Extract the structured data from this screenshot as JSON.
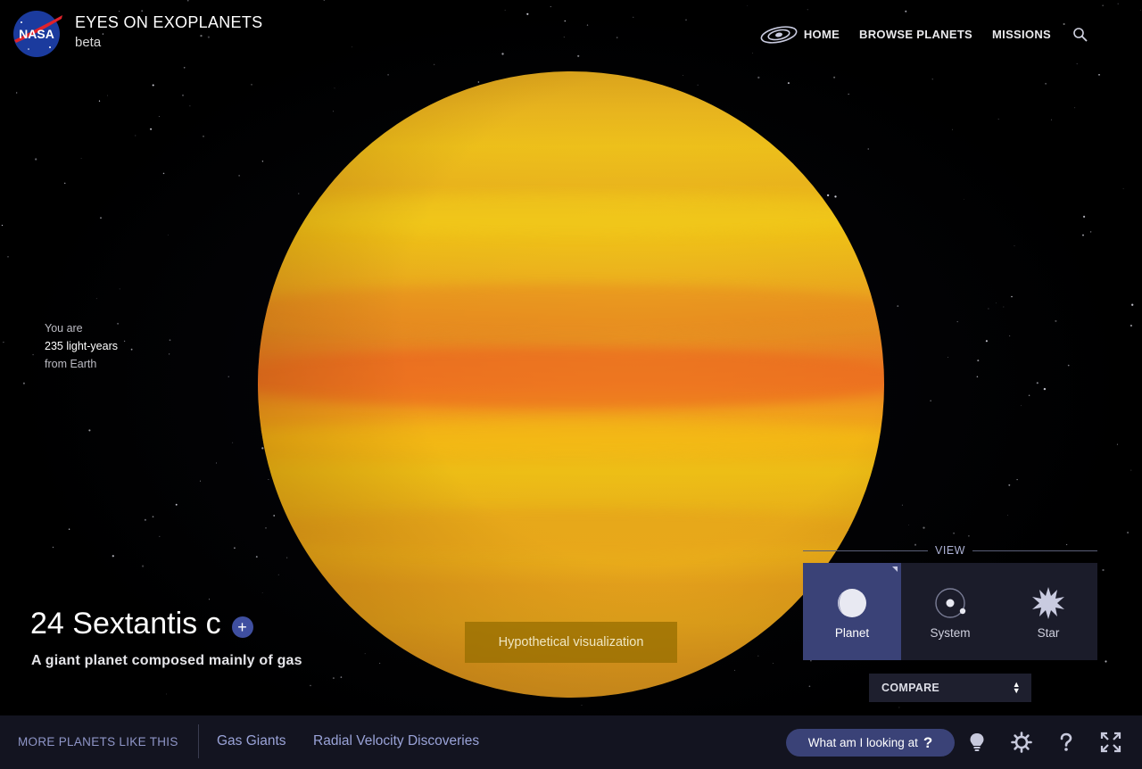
{
  "header": {
    "logo_text": "NASA",
    "title": "EYES ON EXOPLANETS",
    "subtitle": "beta",
    "nav": [
      {
        "label": "HOME"
      },
      {
        "label": "BROWSE PLANETS"
      },
      {
        "label": "MISSIONS"
      }
    ]
  },
  "distance": {
    "prefix": "You are",
    "value": "235 light-years",
    "suffix": "from Earth"
  },
  "planet": {
    "name": "24 Sextantis c",
    "add_label": "+",
    "description": "A giant planet composed mainly of gas"
  },
  "visualization_note": "Hypothetical visualization",
  "view": {
    "label": "VIEW",
    "options": [
      {
        "label": "Planet",
        "icon": "planet-icon",
        "active": true
      },
      {
        "label": "System",
        "icon": "system-icon",
        "active": false
      },
      {
        "label": "Star",
        "icon": "star-icon",
        "active": false
      }
    ]
  },
  "compare": {
    "label": "COMPARE"
  },
  "bottom": {
    "more_label": "MORE PLANETS LIKE THIS",
    "links": [
      "Gas Giants",
      "Radial Velocity Discoveries"
    ],
    "help_label": "What am I looking at",
    "help_mark": "?"
  },
  "colors": {
    "accent": "#3a4277",
    "planet_yellow": "#ecbe1a",
    "planet_orange": "#ee7f22",
    "hypo_bg": "#8f6a00"
  }
}
